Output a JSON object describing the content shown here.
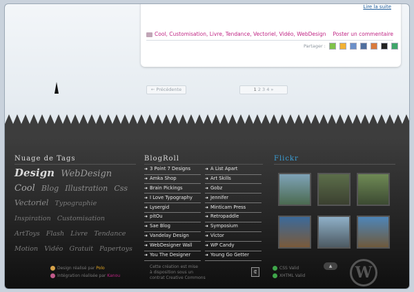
{
  "post": {
    "top_link": "Lire la suite",
    "tags": "Cool, Customisation, Livre, Tendance, Vectoriel, Vidéo, WebDesign",
    "comment_link": "Poster un commentaire",
    "share_label": "Partager :"
  },
  "pagination": {
    "prev_label": "← Précédente",
    "current_page": "1",
    "pages": "2 3 4 »"
  },
  "footer": {
    "tag_cloud_title": "Nuage de Tags",
    "tags": [
      {
        "label": "Design",
        "size": 15,
        "color": "#d9d9d9"
      },
      {
        "label": "WebDesign",
        "size": 13,
        "color": "#9a9a9a"
      },
      {
        "label": "Cool",
        "size": 13,
        "color": "#a8a8a8"
      },
      {
        "label": "Blog",
        "size": 11,
        "color": "#8c8c8c"
      },
      {
        "label": "Illustration",
        "size": 11,
        "color": "#8c8c8c"
      },
      {
        "label": "Css",
        "size": 11,
        "color": "#8c8c8c"
      },
      {
        "label": "Vectoriel",
        "size": 11,
        "color": "#8c8c8c"
      },
      {
        "label": "Typographie",
        "size": 9.5,
        "color": "#7a7a7a"
      },
      {
        "label": "Inspiration",
        "size": 9.5,
        "color": "#7a7a7a"
      },
      {
        "label": "Customisation",
        "size": 9.5,
        "color": "#7a7a7a"
      },
      {
        "label": "ArtToys",
        "size": 9.5,
        "color": "#7a7a7a"
      },
      {
        "label": "Flash",
        "size": 9.5,
        "color": "#7a7a7a"
      },
      {
        "label": "Livre",
        "size": 9.5,
        "color": "#7a7a7a"
      },
      {
        "label": "Tendance",
        "size": 9.5,
        "color": "#7a7a7a"
      },
      {
        "label": "Motion",
        "size": 9.5,
        "color": "#7a7a7a"
      },
      {
        "label": "Vidéo",
        "size": 9.5,
        "color": "#7a7a7a"
      },
      {
        "label": "Gratuit",
        "size": 9.5,
        "color": "#7a7a7a"
      },
      {
        "label": "Papertoys",
        "size": 9.5,
        "color": "#7a7a7a"
      }
    ],
    "blogroll_title": "BlogRoll",
    "blogroll_left": [
      "3 Point 7 Designs",
      "Amka Shop",
      "Brain Pickings",
      "I Love Typography",
      "Lysergid",
      "pitOu",
      "Sae Blog",
      "Vandelay Design",
      "WebDesigner Wall",
      "You The Designer"
    ],
    "blogroll_right": [
      "A List Apart",
      "Art Skills",
      "Gobz",
      "Jennifer",
      "Minticam Press",
      "Retropaddle",
      "Symposium",
      "Victor",
      "WP Candy",
      "Young Go Getter"
    ],
    "flickr_title": "Flickr",
    "credits": {
      "design_prefix": "Design réalisé par",
      "design_author": "Polo",
      "integration_prefix": "Intégration réalisée par",
      "integration_author": "Kanou",
      "license_line1": "Cette création est mise",
      "license_line2": "à disposition sous un",
      "license_line3": "contrat Creative Commons",
      "css_valid": "CSS Valid",
      "xhtml_valid": "XHTML Valid"
    }
  },
  "colors": {
    "accent_pink": "#c02584",
    "flickr_blue": "#3aa0d8"
  }
}
